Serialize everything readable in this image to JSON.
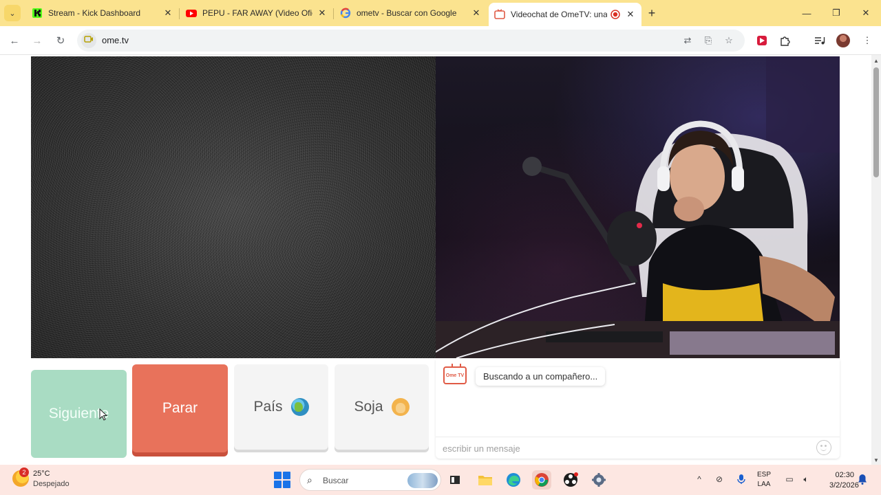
{
  "browser": {
    "tabs": [
      {
        "title": "Stream - Kick Dashboard",
        "favicon": "kick-icon",
        "active": false
      },
      {
        "title": "PEPU - FAR AWAY (Video Oficial)",
        "favicon": "youtube-icon",
        "active": false
      },
      {
        "title": "ometv - Buscar con Google",
        "favicon": "google-icon",
        "active": false
      },
      {
        "title": "Videochat de OmeTV: una alternativa",
        "favicon": "ometv-icon",
        "active": true
      }
    ],
    "url": "ome.tv"
  },
  "page": {
    "buttons": {
      "next": "Siguiente",
      "stop": "Parar",
      "country": "País",
      "gender": "Soja"
    },
    "chat": {
      "logo_text": "Ome TV",
      "status_message": "Buscando a un compañero...",
      "input_placeholder": "escribir un mensaje"
    }
  },
  "taskbar": {
    "weather": {
      "badge": "2",
      "temp": "25°C",
      "desc": "Despejado"
    },
    "search_label": "Buscar",
    "lang": {
      "line1": "ESP",
      "line2": "LAA"
    },
    "clock": {
      "time": "02:30",
      "date": "3/2/2026"
    }
  },
  "colors": {
    "tabstrip": "#fbe38f",
    "next_button": "#a9dcc3",
    "stop_button": "#e8725b",
    "ometv_red": "#e05a45",
    "taskbar": "#fde7e2"
  }
}
